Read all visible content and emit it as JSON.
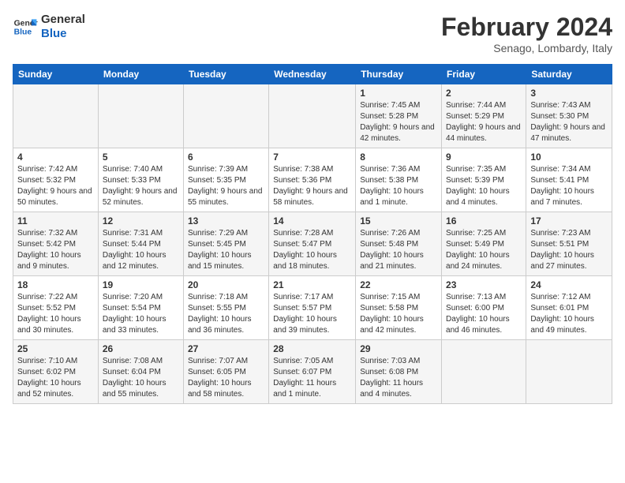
{
  "logo": {
    "line1": "General",
    "line2": "Blue"
  },
  "title": "February 2024",
  "location": "Senago, Lombardy, Italy",
  "days_of_week": [
    "Sunday",
    "Monday",
    "Tuesday",
    "Wednesday",
    "Thursday",
    "Friday",
    "Saturday"
  ],
  "weeks": [
    [
      {
        "day": "",
        "info": ""
      },
      {
        "day": "",
        "info": ""
      },
      {
        "day": "",
        "info": ""
      },
      {
        "day": "",
        "info": ""
      },
      {
        "day": "1",
        "info": "Sunrise: 7:45 AM\nSunset: 5:28 PM\nDaylight: 9 hours and 42 minutes."
      },
      {
        "day": "2",
        "info": "Sunrise: 7:44 AM\nSunset: 5:29 PM\nDaylight: 9 hours and 44 minutes."
      },
      {
        "day": "3",
        "info": "Sunrise: 7:43 AM\nSunset: 5:30 PM\nDaylight: 9 hours and 47 minutes."
      }
    ],
    [
      {
        "day": "4",
        "info": "Sunrise: 7:42 AM\nSunset: 5:32 PM\nDaylight: 9 hours and 50 minutes."
      },
      {
        "day": "5",
        "info": "Sunrise: 7:40 AM\nSunset: 5:33 PM\nDaylight: 9 hours and 52 minutes."
      },
      {
        "day": "6",
        "info": "Sunrise: 7:39 AM\nSunset: 5:35 PM\nDaylight: 9 hours and 55 minutes."
      },
      {
        "day": "7",
        "info": "Sunrise: 7:38 AM\nSunset: 5:36 PM\nDaylight: 9 hours and 58 minutes."
      },
      {
        "day": "8",
        "info": "Sunrise: 7:36 AM\nSunset: 5:38 PM\nDaylight: 10 hours and 1 minute."
      },
      {
        "day": "9",
        "info": "Sunrise: 7:35 AM\nSunset: 5:39 PM\nDaylight: 10 hours and 4 minutes."
      },
      {
        "day": "10",
        "info": "Sunrise: 7:34 AM\nSunset: 5:41 PM\nDaylight: 10 hours and 7 minutes."
      }
    ],
    [
      {
        "day": "11",
        "info": "Sunrise: 7:32 AM\nSunset: 5:42 PM\nDaylight: 10 hours and 9 minutes."
      },
      {
        "day": "12",
        "info": "Sunrise: 7:31 AM\nSunset: 5:44 PM\nDaylight: 10 hours and 12 minutes."
      },
      {
        "day": "13",
        "info": "Sunrise: 7:29 AM\nSunset: 5:45 PM\nDaylight: 10 hours and 15 minutes."
      },
      {
        "day": "14",
        "info": "Sunrise: 7:28 AM\nSunset: 5:47 PM\nDaylight: 10 hours and 18 minutes."
      },
      {
        "day": "15",
        "info": "Sunrise: 7:26 AM\nSunset: 5:48 PM\nDaylight: 10 hours and 21 minutes."
      },
      {
        "day": "16",
        "info": "Sunrise: 7:25 AM\nSunset: 5:49 PM\nDaylight: 10 hours and 24 minutes."
      },
      {
        "day": "17",
        "info": "Sunrise: 7:23 AM\nSunset: 5:51 PM\nDaylight: 10 hours and 27 minutes."
      }
    ],
    [
      {
        "day": "18",
        "info": "Sunrise: 7:22 AM\nSunset: 5:52 PM\nDaylight: 10 hours and 30 minutes."
      },
      {
        "day": "19",
        "info": "Sunrise: 7:20 AM\nSunset: 5:54 PM\nDaylight: 10 hours and 33 minutes."
      },
      {
        "day": "20",
        "info": "Sunrise: 7:18 AM\nSunset: 5:55 PM\nDaylight: 10 hours and 36 minutes."
      },
      {
        "day": "21",
        "info": "Sunrise: 7:17 AM\nSunset: 5:57 PM\nDaylight: 10 hours and 39 minutes."
      },
      {
        "day": "22",
        "info": "Sunrise: 7:15 AM\nSunset: 5:58 PM\nDaylight: 10 hours and 42 minutes."
      },
      {
        "day": "23",
        "info": "Sunrise: 7:13 AM\nSunset: 6:00 PM\nDaylight: 10 hours and 46 minutes."
      },
      {
        "day": "24",
        "info": "Sunrise: 7:12 AM\nSunset: 6:01 PM\nDaylight: 10 hours and 49 minutes."
      }
    ],
    [
      {
        "day": "25",
        "info": "Sunrise: 7:10 AM\nSunset: 6:02 PM\nDaylight: 10 hours and 52 minutes."
      },
      {
        "day": "26",
        "info": "Sunrise: 7:08 AM\nSunset: 6:04 PM\nDaylight: 10 hours and 55 minutes."
      },
      {
        "day": "27",
        "info": "Sunrise: 7:07 AM\nSunset: 6:05 PM\nDaylight: 10 hours and 58 minutes."
      },
      {
        "day": "28",
        "info": "Sunrise: 7:05 AM\nSunset: 6:07 PM\nDaylight: 11 hours and 1 minute."
      },
      {
        "day": "29",
        "info": "Sunrise: 7:03 AM\nSunset: 6:08 PM\nDaylight: 11 hours and 4 minutes."
      },
      {
        "day": "",
        "info": ""
      },
      {
        "day": "",
        "info": ""
      }
    ]
  ]
}
